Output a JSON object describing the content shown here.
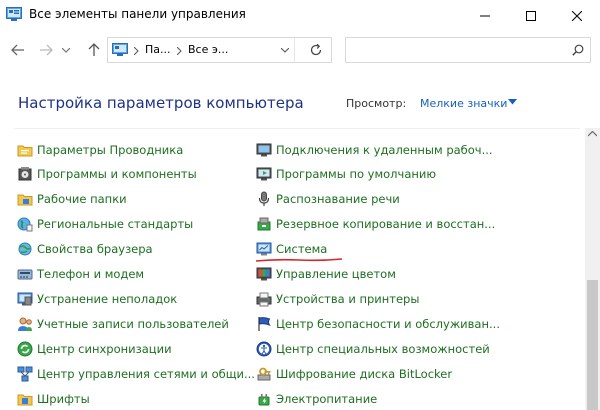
{
  "window": {
    "title": "Все элементы панели управления",
    "minimize_glyph": "—",
    "maximize_glyph": "☐",
    "close_glyph": "✕"
  },
  "nav": {
    "breadcrumb": [
      "Па...",
      "Все э..."
    ],
    "search_placeholder": ""
  },
  "header": {
    "title": "Настройка параметров компьютера",
    "view_label": "Просмотр:",
    "view_value": "Мелкие значки"
  },
  "colors": {
    "link_green": "#1e6e21",
    "heading_blue": "#1e3287",
    "accent_blue": "#1560bd",
    "annotation_red": "#d7262b"
  },
  "items_left": [
    {
      "label": "Параметры Проводника",
      "icon": "folder-options-icon"
    },
    {
      "label": "Программы и компоненты",
      "icon": "programs-features-icon"
    },
    {
      "label": "Рабочие папки",
      "icon": "work-folders-icon"
    },
    {
      "label": "Региональные стандарты",
      "icon": "region-icon"
    },
    {
      "label": "Свойства браузера",
      "icon": "internet-options-icon"
    },
    {
      "label": "Телефон и модем",
      "icon": "phone-modem-icon"
    },
    {
      "label": "Устранение неполадок",
      "icon": "troubleshooting-icon"
    },
    {
      "label": "Учетные записи пользователей",
      "icon": "user-accounts-icon"
    },
    {
      "label": "Центр синхронизации",
      "icon": "sync-center-icon"
    },
    {
      "label": "Центр управления сетями и общи...",
      "icon": "network-center-icon"
    },
    {
      "label": "Шрифты",
      "icon": "fonts-icon"
    }
  ],
  "items_right": [
    {
      "label": "Подключения к удаленным рабоч...",
      "icon": "remote-desktop-icon"
    },
    {
      "label": "Программы по умолчанию",
      "icon": "default-programs-icon"
    },
    {
      "label": "Распознавание речи",
      "icon": "speech-recognition-icon"
    },
    {
      "label": "Резервное копирование и восстан...",
      "icon": "backup-restore-icon"
    },
    {
      "label": "Система",
      "icon": "system-icon"
    },
    {
      "label": "Управление цветом",
      "icon": "color-management-icon"
    },
    {
      "label": "Устройства и принтеры",
      "icon": "devices-printers-icon"
    },
    {
      "label": "Центр безопасности и обслуживан...",
      "icon": "security-maintenance-icon"
    },
    {
      "label": "Центр специальных возможностей",
      "icon": "ease-of-access-icon"
    },
    {
      "label": "Шифрование диска BitLocker",
      "icon": "bitlocker-icon"
    },
    {
      "label": "Электропитание",
      "icon": "power-options-icon"
    }
  ]
}
